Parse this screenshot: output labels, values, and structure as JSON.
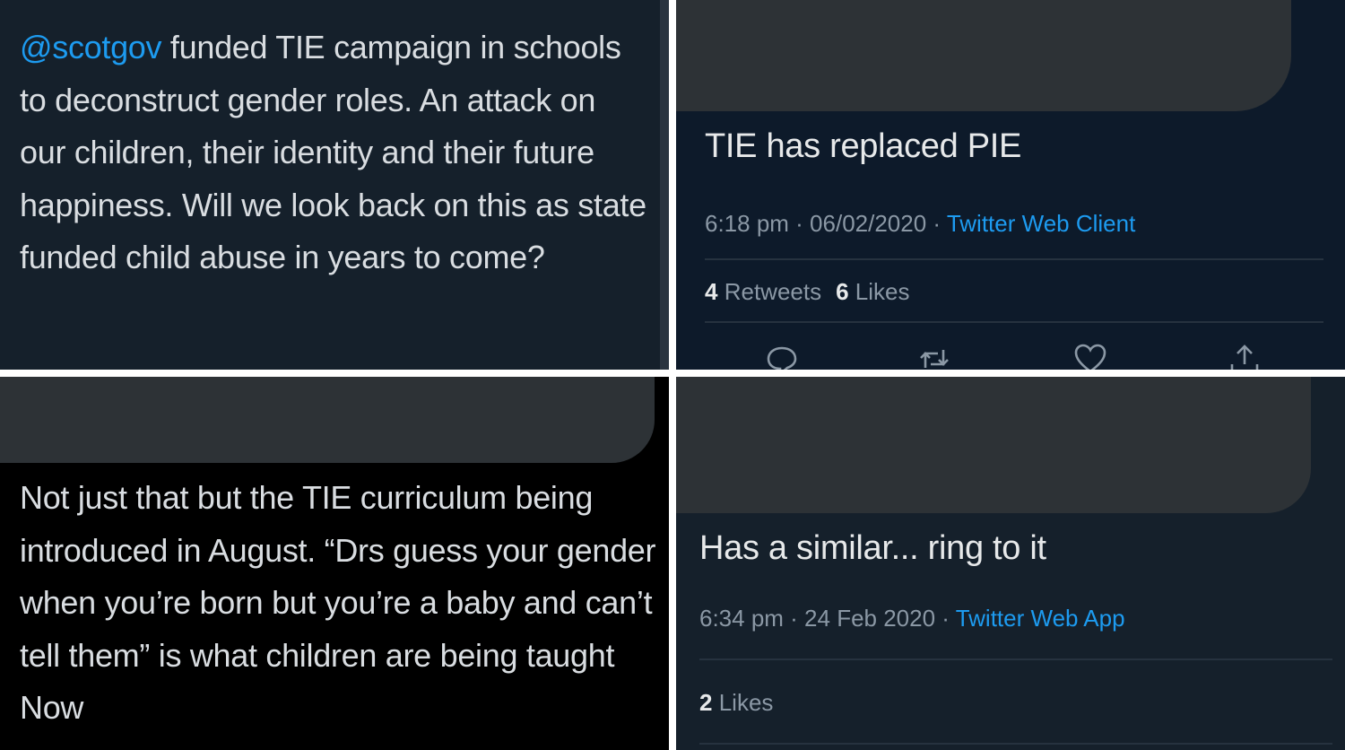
{
  "panel_top_left": {
    "mention": "@scotgov",
    "text": " funded TIE campaign in schools to deconstruct gender roles. An attack on our children, their identity and their future happiness. Will we look back on this as state funded child abuse in years to come?"
  },
  "panel_top_right": {
    "text": "TIE has replaced PIE",
    "time": "6:18 pm · 06/02/2020 · ",
    "client": "Twitter Web Client",
    "retweets_count": "4",
    "retweets_label": "Retweets",
    "likes_count": "6",
    "likes_label": "Likes",
    "icons": [
      "reply-icon",
      "retweet-icon",
      "like-icon",
      "share-icon"
    ]
  },
  "panel_bottom_left": {
    "text": "Not just that but the TIE curriculum being introduced in August. “Drs guess your gender when you’re born but you’re a baby and can’t tell them” is what children are being taught Now"
  },
  "panel_bottom_right": {
    "text": "Has a similar... ring to it",
    "time": "6:34 pm · 24 Feb 2020 · ",
    "client": "Twitter Web App",
    "likes_count": "2",
    "likes_label": "Likes"
  },
  "colors": {
    "background_dim": "#15202b",
    "link_blue": "#1d9bf0",
    "muted_text": "#8b98a5",
    "redaction": "#2d3236"
  }
}
